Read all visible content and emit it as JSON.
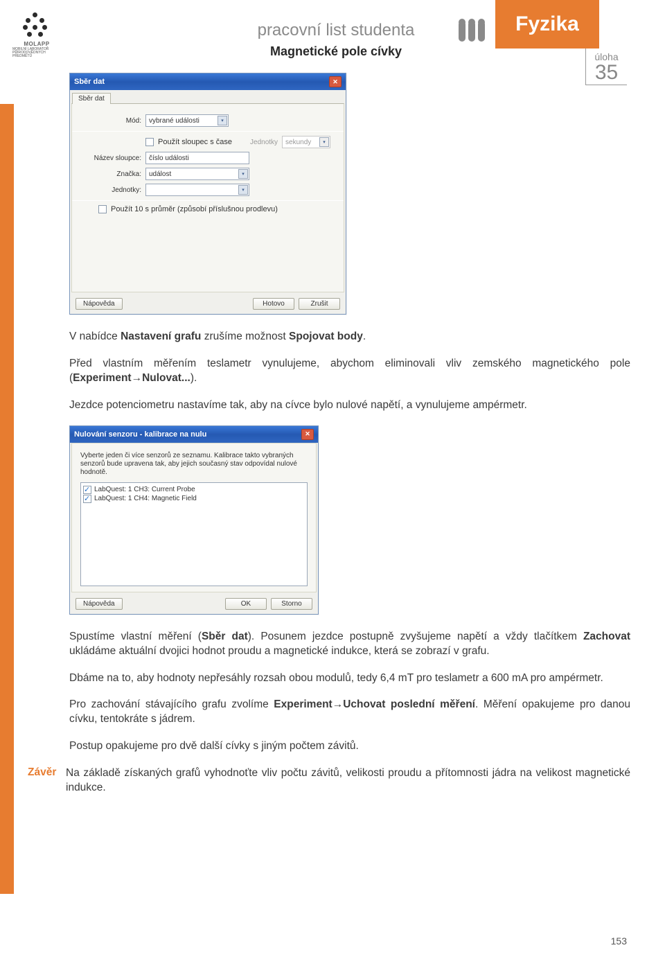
{
  "logo": {
    "name": "MOLAPP",
    "sub": "MOBILNÍ LABORATOŘ PŘÍRODOVĚDNÝCH PŘEDMĚTŮ"
  },
  "header": {
    "title": "pracovní list studenta",
    "subtitle": "Magnetické pole cívky"
  },
  "subject": "Fyzika",
  "task": {
    "label": "úloha",
    "number": "35"
  },
  "dialog1": {
    "title": "Sběr dat",
    "tab": "Sběr dat",
    "fields": {
      "mod_label": "Mód:",
      "mod_value": "vybrané události",
      "use_time_col": "Použít sloupec s čase",
      "jednotky_label": "Jednotky",
      "jednotky_disabled": "sekundy",
      "nazev_label": "Název sloupce:",
      "nazev_value": "číslo události",
      "znacka_label": "Značka:",
      "znacka_value": "událost",
      "jednotky2_label": "Jednotky:",
      "jednotky2_value": "",
      "prumer": "Použít 10 s průměr (způsobí příslušnou prodlevu)"
    },
    "buttons": {
      "help": "Nápověda",
      "done": "Hotovo",
      "cancel": "Zrušit"
    }
  },
  "para1_pre": "V nabídce ",
  "para1_b1": "Nastavení grafu",
  "para1_mid": " zrušíme možnost ",
  "para1_b2": "Spojovat body",
  "para1_post": ".",
  "para2_pre": "Před vlastním měřením teslametr vynulujeme, abychom eliminovali vliv zemského magnetického pole (",
  "para2_b": "Experiment",
  "para2_arrow": "→",
  "para2_b2": "Nulovat...",
  "para2_post": ").",
  "para3": "Jezdce potenciometru nastavíme tak, aby na cívce bylo nulové napětí, a vynulujeme ampérmetr.",
  "dialog2": {
    "title": "Nulování senzoru - kalibrace na nulu",
    "desc": "Vyberte jeden či více senzorů ze seznamu. Kalibrace takto vybraných senzorů bude upravena tak, aby jejich současný stav odpovídal nulové hodnotě.",
    "items": [
      "LabQuest: 1 CH3: Current Probe",
      "LabQuest: 1 CH4: Magnetic Field"
    ],
    "buttons": {
      "help": "Nápověda",
      "ok": "OK",
      "storno": "Storno"
    }
  },
  "para4_pre": "Spustíme vlastní měření (",
  "para4_b": "Sběr dat",
  "para4_post": "). Posunem jezdce postupně zvyšujeme napětí a vždy tlačítkem ",
  "para4_b2": "Zachovat",
  "para4_post2": " ukládáme aktuální dvojici hodnot proudu a magnetické indukce, která se zobrazí v grafu.",
  "para5": "Dbáme na to, aby hodnoty nepřesáhly rozsah obou modulů, tedy 6,4 mT pro teslametr a 600 mA pro ampérmetr.",
  "para6_pre": "Pro zachování stávajícího grafu zvolíme ",
  "para6_b": "Experiment",
  "para6_arrow": "→",
  "para6_b2": "Uchovat poslední měření",
  "para6_post": ". Měření opakujeme pro danou cívku, tentokráte s jádrem.",
  "para7": "Postup opakujeme pro dvě další cívky s jiným počtem závitů.",
  "zaver_label": "Závěr",
  "zaver_text": "Na základě získaných grafů vyhodnoťte vliv počtu závitů, velikosti proudu a přítomnosti jádra na velikost magnetické indukce.",
  "page_number": "153"
}
